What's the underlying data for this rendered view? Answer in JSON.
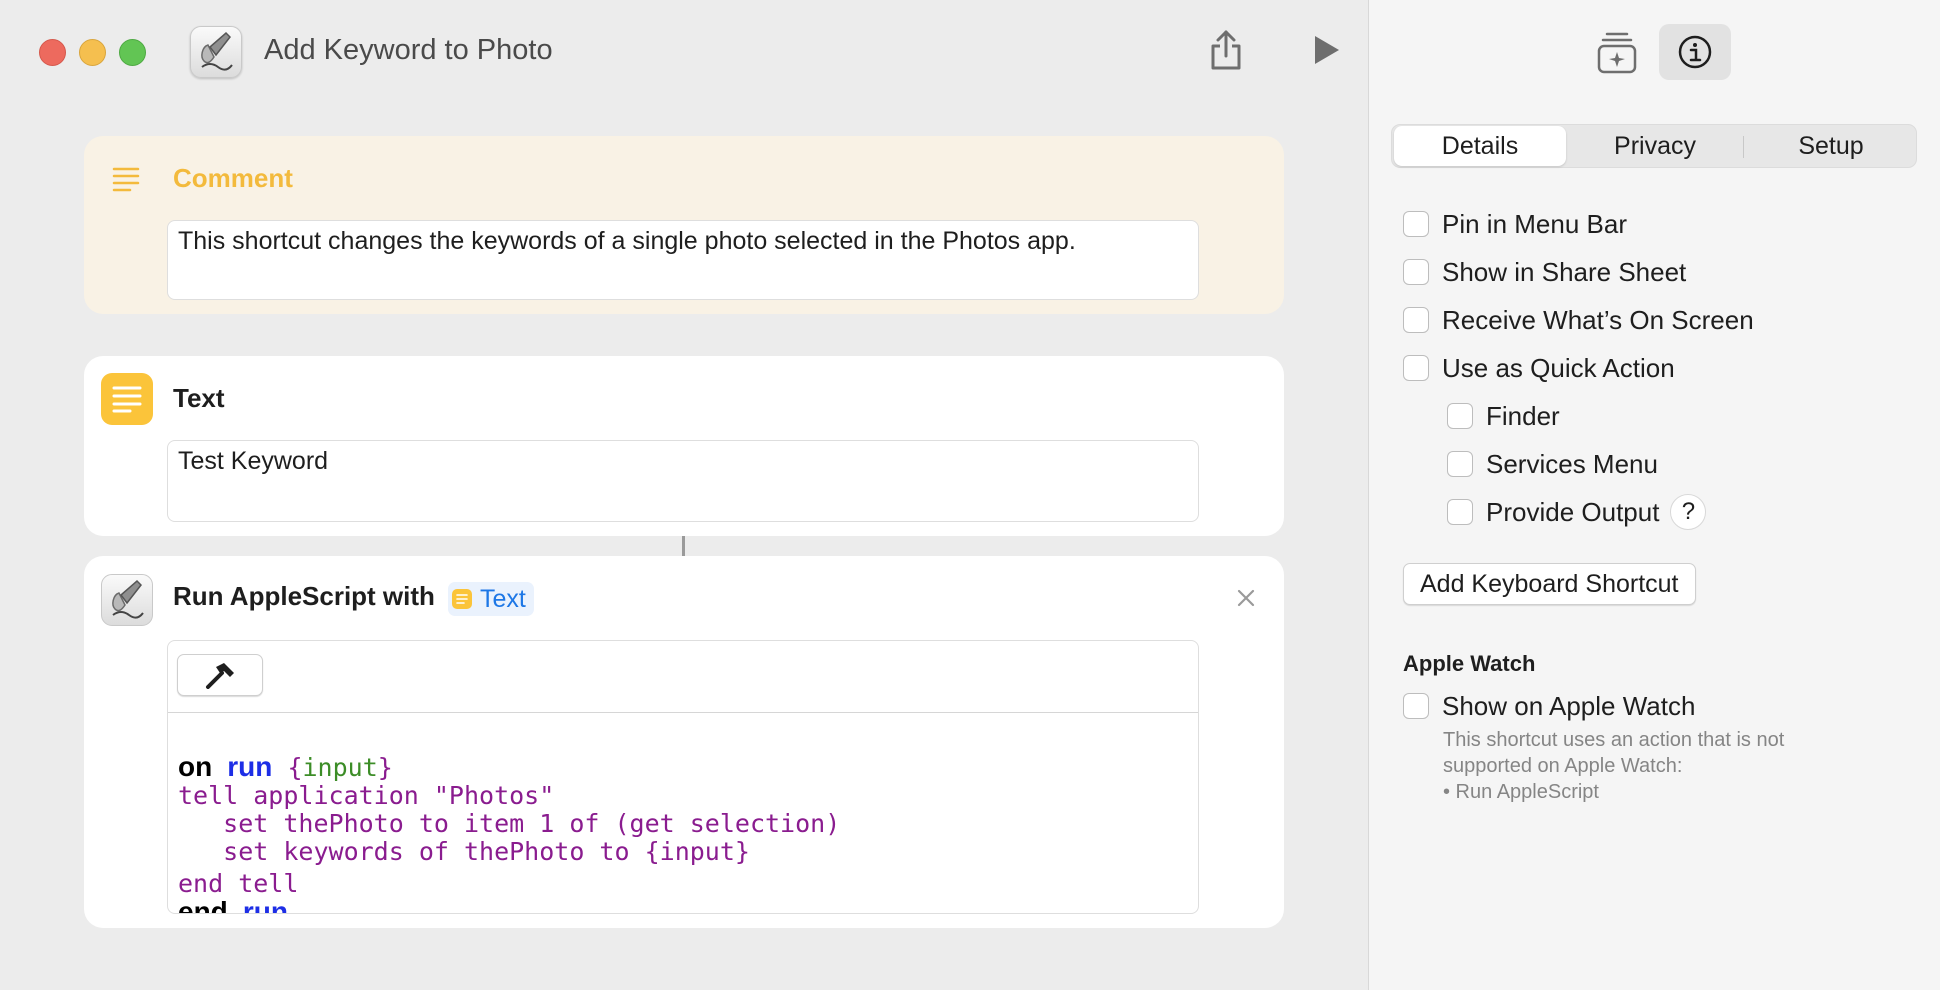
{
  "window": {
    "title": "Add Keyword to Photo"
  },
  "actions": [
    {
      "type": "comment",
      "label": "Comment",
      "text": "This shortcut changes the keywords of a single photo selected in the Photos app."
    },
    {
      "type": "text",
      "label": "Text",
      "value": "Test Keyword"
    },
    {
      "type": "run-applescript",
      "label": "Run AppleScript with",
      "variable": "Text",
      "code": {
        "l1_kw": "on",
        "l1_run": "run",
        "l1_open": " {",
        "l1_param": "input",
        "l1_close": "}",
        "l2": "tell application \"Photos\"",
        "l3": "   set thePhoto to item 1 of (get selection)",
        "l4": "   set keywords of thePhoto to {input}",
        "l5": "end tell",
        "l6_kw": "end",
        "l6_run": "run"
      }
    }
  ],
  "inspector": {
    "tabs": [
      "Details",
      "Privacy",
      "Setup"
    ],
    "active_tab": "Details",
    "options": [
      {
        "label": "Pin in Menu Bar",
        "checked": false
      },
      {
        "label": "Show in Share Sheet",
        "checked": false
      },
      {
        "label": "Receive What’s On Screen",
        "checked": false
      },
      {
        "label": "Use as Quick Action",
        "checked": false
      },
      {
        "label": "Finder",
        "checked": false
      },
      {
        "label": "Services Menu",
        "checked": false
      },
      {
        "label": "Provide Output",
        "checked": false
      }
    ],
    "help_glyph": "?",
    "keyboard_button": "Add Keyboard Shortcut",
    "apple_watch": {
      "heading": "Apple Watch",
      "option": "Show on Apple Watch",
      "note_line1": "This shortcut uses an action that is not",
      "note_line2": "supported on Apple Watch:",
      "note_line3": "• Run AppleScript"
    }
  },
  "colors": {
    "comment_accent": "#f3ba3c",
    "text_action": "#fbc43a",
    "variable_blue": "#1d77e6",
    "script_purple": "#8a1c8f",
    "script_green": "#3c8d27",
    "script_blue": "#1d2ee6"
  },
  "icons": {
    "app": "script-editor-icon",
    "share": "share-icon",
    "run": "play-icon",
    "library": "add-to-library-icon",
    "info": "info-icon",
    "comment": "comment-lines-icon",
    "text": "text-lines-icon",
    "close": "close-icon",
    "compile": "hammer-icon"
  }
}
